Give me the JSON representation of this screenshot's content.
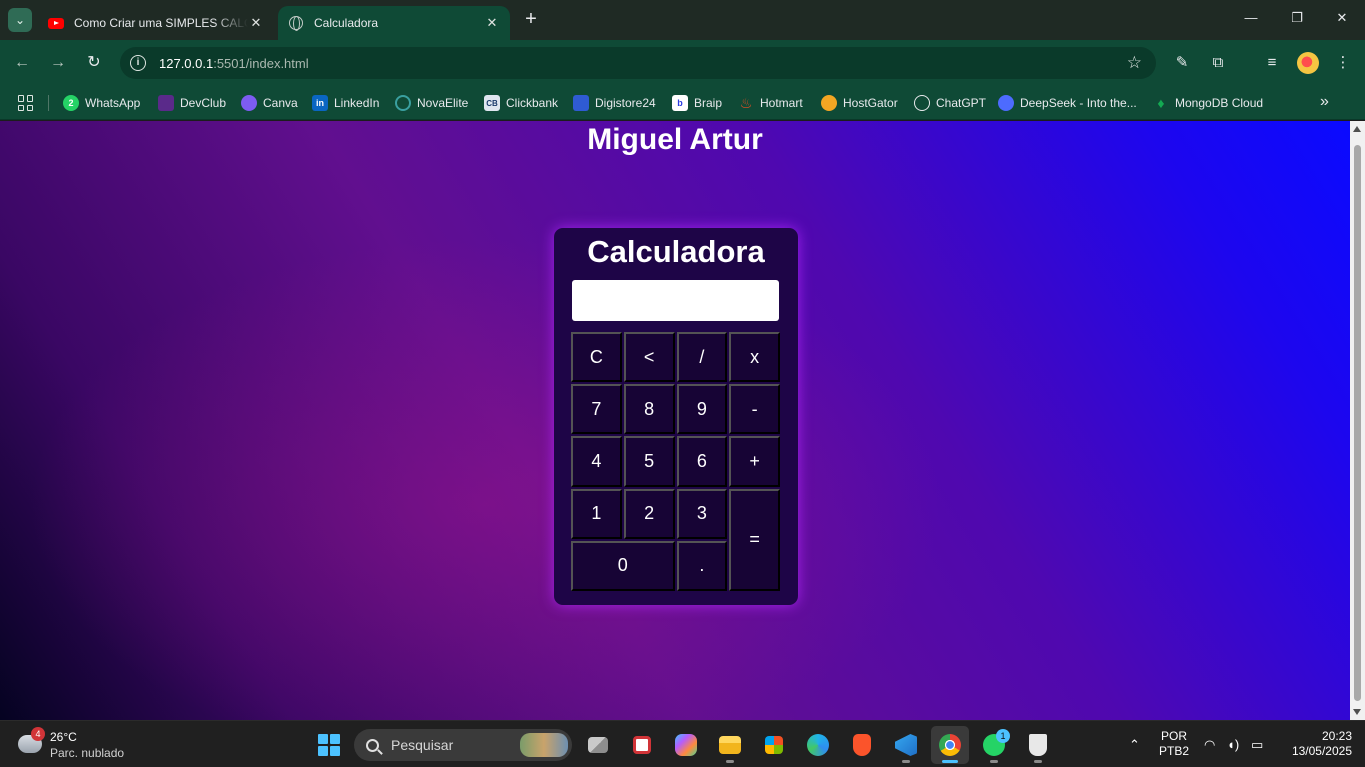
{
  "browser": {
    "tabs": [
      {
        "title": "Como Criar uma SIMPLES CALC",
        "active": false,
        "favicon": "youtube-icon"
      },
      {
        "title": "Calculadora",
        "active": true,
        "favicon": "globe-icon"
      }
    ],
    "new_tab": "+",
    "window_controls": {
      "minimize": "—",
      "restore": "❐",
      "close": "✕"
    },
    "address": {
      "host": "127.0.0.1",
      "path": ":5501/index.html"
    },
    "bookmarks": [
      {
        "label": "WhatsApp",
        "icon": "whatsapp-icon",
        "color": "#25d366"
      },
      {
        "label": "DevClub",
        "icon": "devclub-icon",
        "color": "#7b2cbf"
      },
      {
        "label": "Canva",
        "icon": "canva-icon",
        "color": "#7d5cf2"
      },
      {
        "label": "LinkedIn",
        "icon": "linkedin-icon",
        "color": "#0a66c2"
      },
      {
        "label": "NovaElite",
        "icon": "novaelite-icon",
        "color": "#3aa0a0"
      },
      {
        "label": "Clickbank",
        "icon": "clickbank-icon",
        "color": "#dfe6f0"
      },
      {
        "label": "Digistore24",
        "icon": "digistore-icon",
        "color": "#2f5bd3"
      },
      {
        "label": "Braip",
        "icon": "braip-icon",
        "color": "#ffffff"
      },
      {
        "label": "Hotmart",
        "icon": "hotmart-icon",
        "color": "#f04e23"
      },
      {
        "label": "HostGator",
        "icon": "hostgator-icon",
        "color": "#f3a623"
      },
      {
        "label": "ChatGPT",
        "icon": "chatgpt-icon",
        "color": "#e8eaed"
      },
      {
        "label": "DeepSeek - Into the...",
        "icon": "deepseek-icon",
        "color": "#4d6bfe"
      },
      {
        "label": "MongoDB Cloud",
        "icon": "mongodb-icon",
        "color": "#13aa52"
      }
    ]
  },
  "page": {
    "heading": "Miguel Artur",
    "calculator": {
      "title": "Calculadora",
      "display_value": "",
      "keys": [
        "C",
        "<",
        "/",
        "x",
        "7",
        "8",
        "9",
        "-",
        "4",
        "5",
        "6",
        "+",
        "1",
        "2",
        "3",
        "=",
        "0",
        "."
      ]
    }
  },
  "taskbar": {
    "weather": {
      "temp": "26°C",
      "desc": "Parc. nublado",
      "badge": "4"
    },
    "search_placeholder": "Pesquisar",
    "whatsapp_badge": "1",
    "language": "POR",
    "layout": "PTB2",
    "time": "20:23",
    "date": "13/05/2025"
  }
}
